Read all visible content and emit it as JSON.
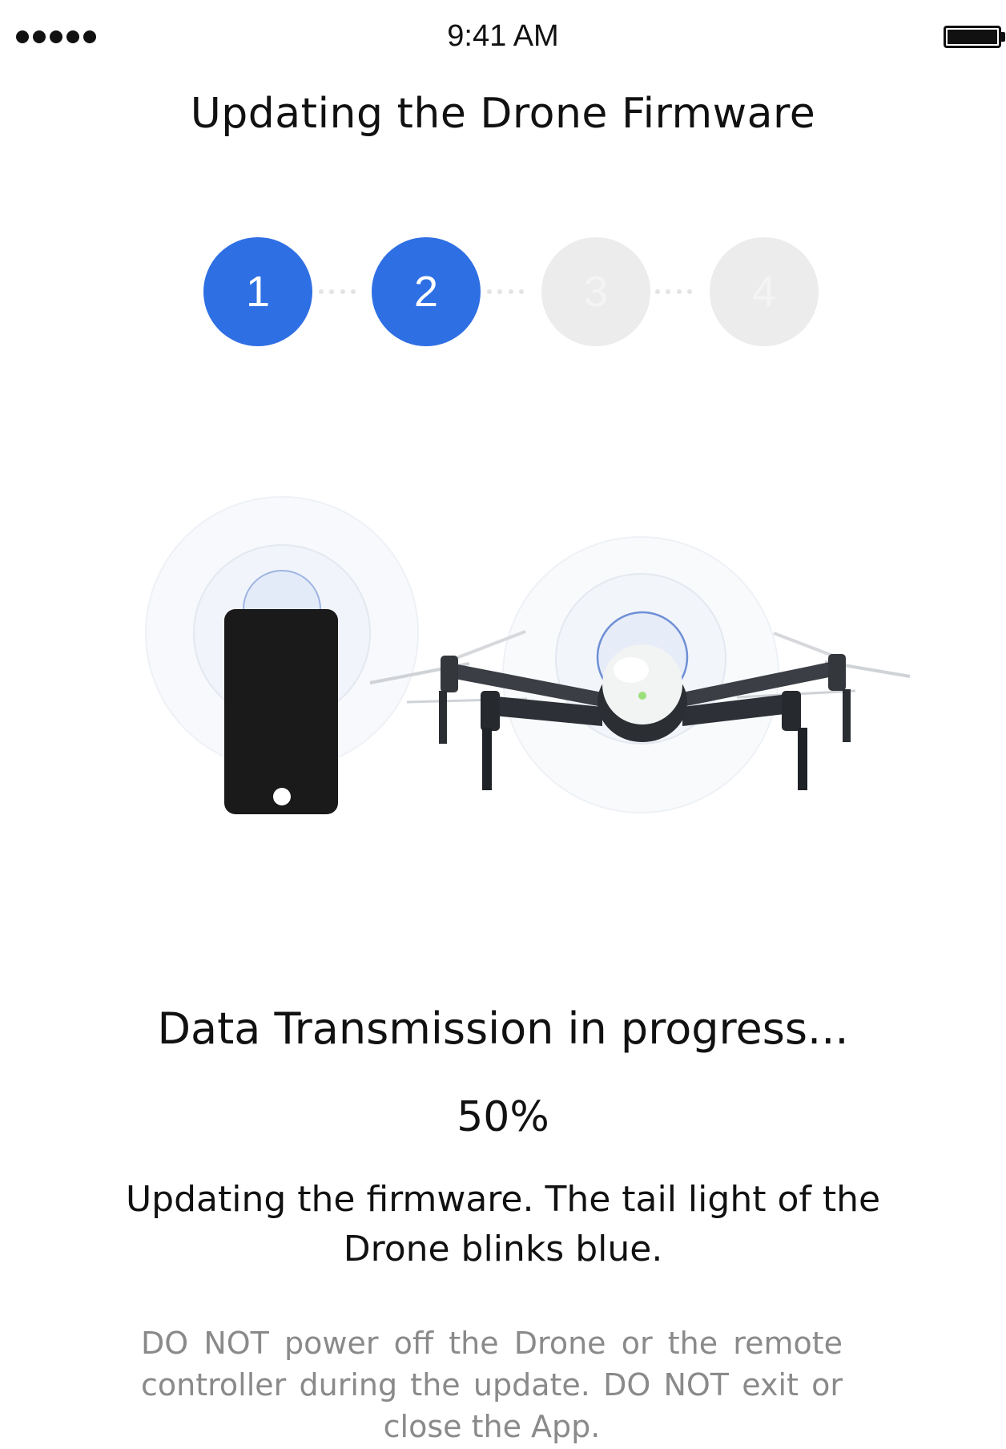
{
  "status_bar": {
    "time": "9:41 AM",
    "signal_icon": "signal-dots-icon",
    "battery_icon": "battery-full-icon"
  },
  "page": {
    "title": "Updating the Drone Firmware"
  },
  "stepper": {
    "current_step": 2,
    "total_steps": 4,
    "steps": [
      {
        "label": "1",
        "state": "completed"
      },
      {
        "label": "2",
        "state": "active"
      },
      {
        "label": "3",
        "state": "pending"
      },
      {
        "label": "4",
        "state": "pending"
      }
    ]
  },
  "illustration": {
    "phone_icon": "smartphone-icon",
    "drone_icon": "drone-icon",
    "signal_icon": "wireless-signal-icon"
  },
  "status": {
    "heading": "Data Transmission in progress...",
    "progress_label": "50%",
    "progress_fraction": 0.5
  },
  "description": "Updating the firmware. The tail light of the Drone blinks blue.",
  "warning": "DO NOT power off the Drone or the remote controller during the update. DO NOT exit or close the App.",
  "colors": {
    "accent": "#2f6fe4",
    "inactive_step": "#ececec",
    "warning_text": "#8a8a8a"
  }
}
